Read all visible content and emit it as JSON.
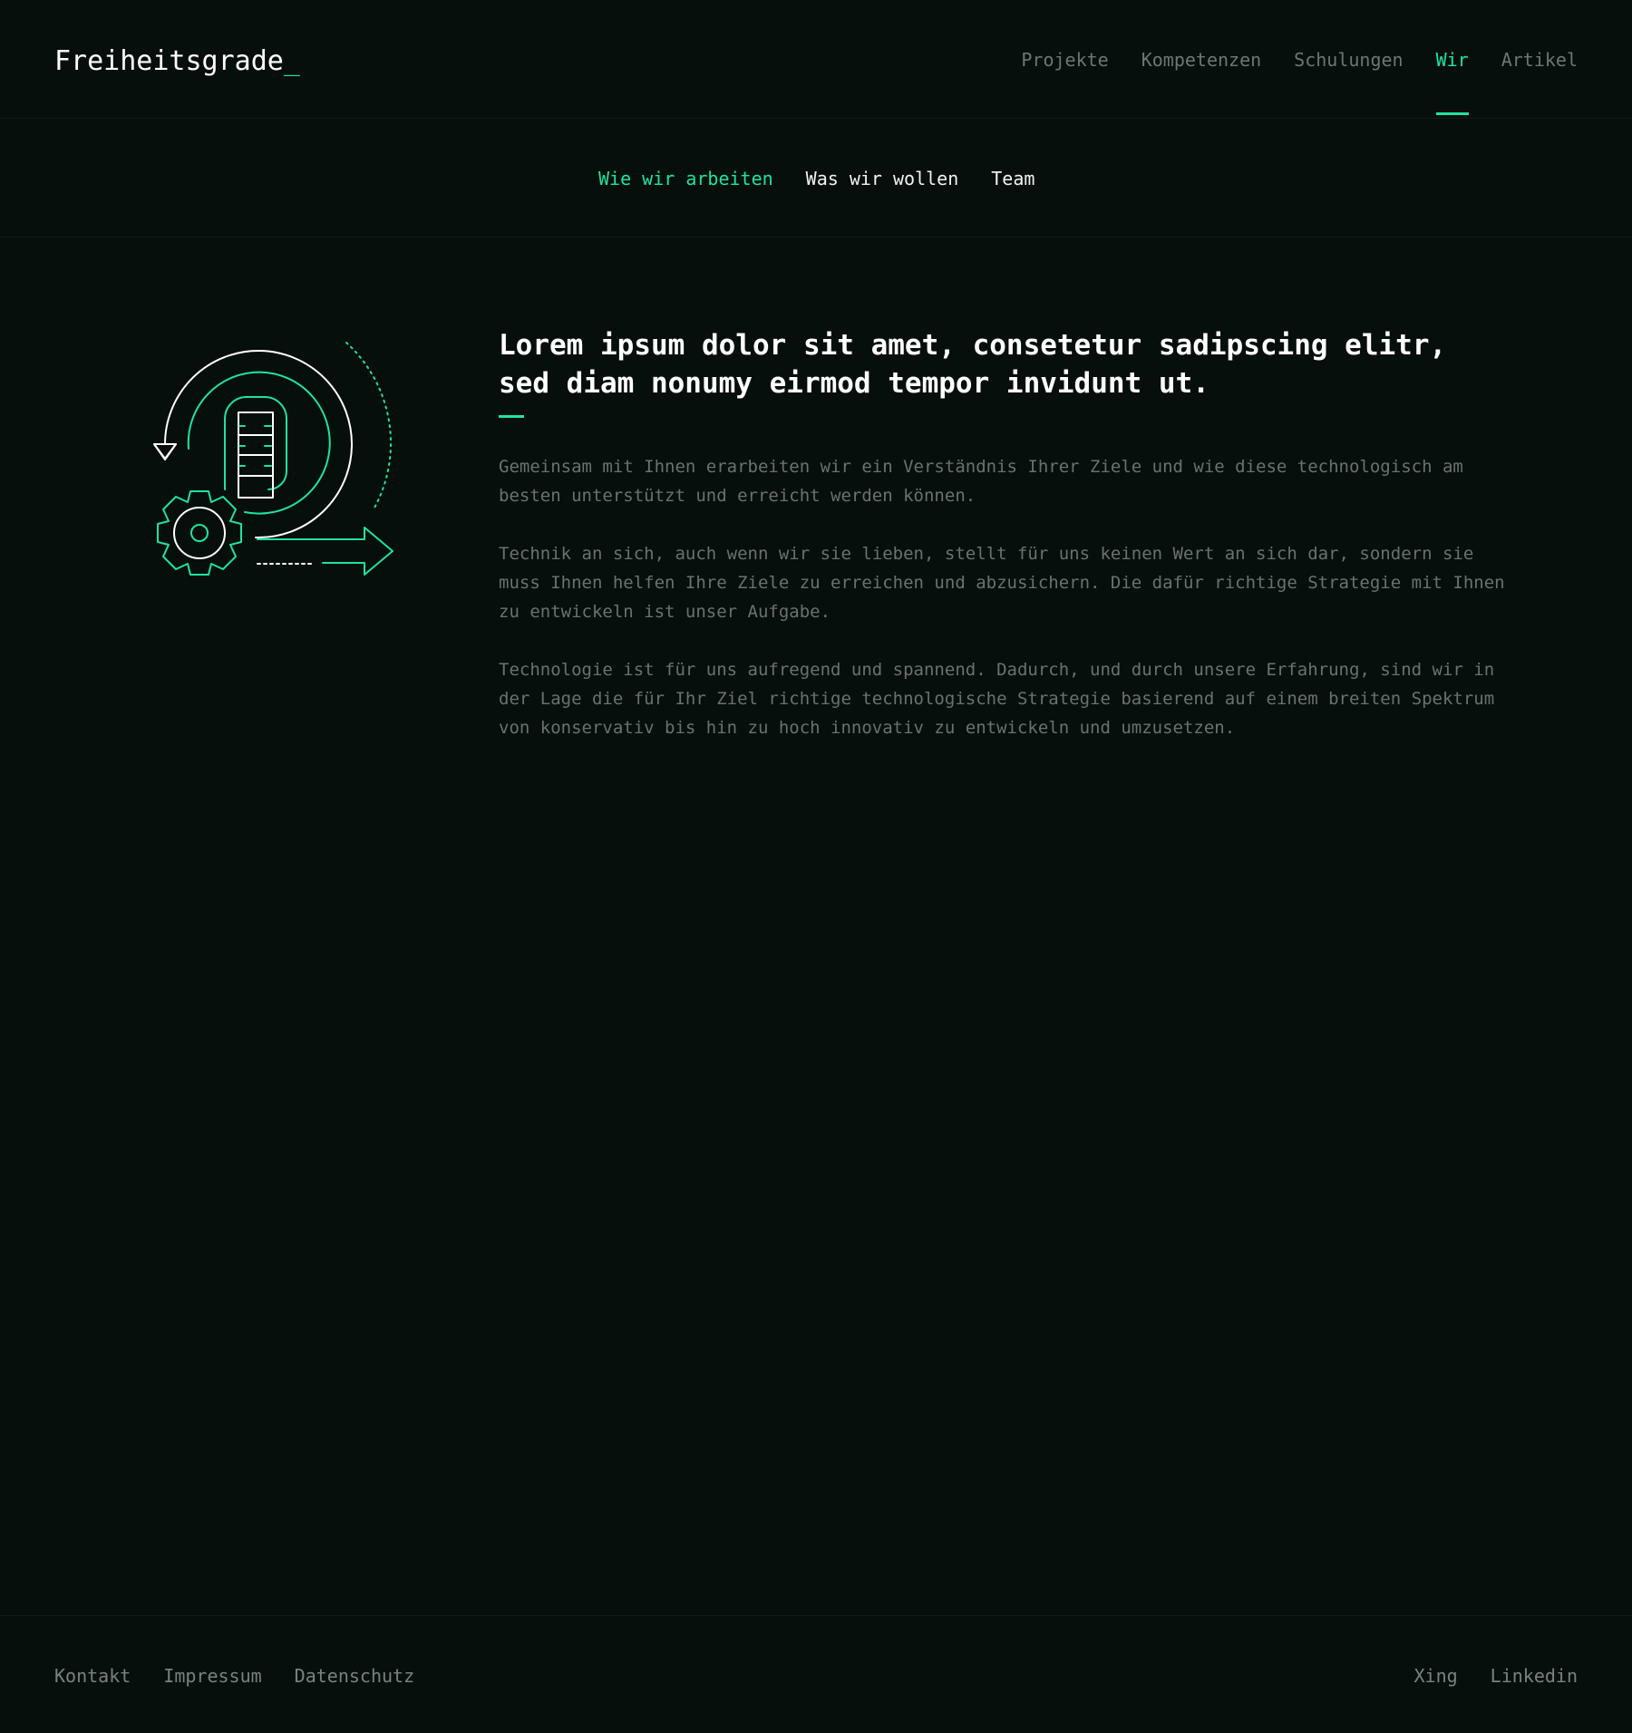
{
  "brand": {
    "name": "Freiheitsgrade",
    "cursor": "_",
    "accent_color": "#1ee3a0",
    "background_color": "#070f0d"
  },
  "main_nav": {
    "items": [
      {
        "label": "Projekte",
        "active": false
      },
      {
        "label": "Kompetenzen",
        "active": false
      },
      {
        "label": "Schulungen",
        "active": false
      },
      {
        "label": "Wir",
        "active": true
      },
      {
        "label": "Artikel",
        "active": false
      }
    ]
  },
  "sub_nav": {
    "items": [
      {
        "label": "Wie wir arbeiten",
        "active": true
      },
      {
        "label": "Was wir wollen",
        "active": false
      },
      {
        "label": "Team",
        "active": false
      }
    ]
  },
  "illustration": {
    "icon": "process-gear-arrow-icon"
  },
  "content": {
    "headline": "Lorem ipsum dolor sit amet, consetetur sadipscing elitr, sed diam nonumy eirmod tempor invidunt ut.",
    "paragraphs": [
      "Gemeinsam mit Ihnen erarbeiten wir ein Verständnis Ihrer Ziele und wie diese technologisch am besten unterstützt und erreicht werden können.",
      "Technik an sich, auch wenn wir sie lieben, stellt für uns keinen Wert an sich dar, sondern sie muss Ihnen helfen Ihre Ziele zu erreichen und abzusichern. Die dafür richtige Strategie mit Ihnen zu entwickeln ist unser Aufgabe.",
      "Technologie ist für uns aufregend und spannend. Dadurch, und durch unsere Erfahrung, sind wir in der Lage die für Ihr Ziel richtige technologische Strategie basierend auf einem breiten Spektrum von konservativ bis hin zu hoch innovativ zu entwickeln und umzusetzen."
    ]
  },
  "footer": {
    "left_links": [
      "Kontakt",
      "Impressum",
      "Datenschutz"
    ],
    "right_links": [
      "Xing",
      "Linkedin"
    ]
  }
}
